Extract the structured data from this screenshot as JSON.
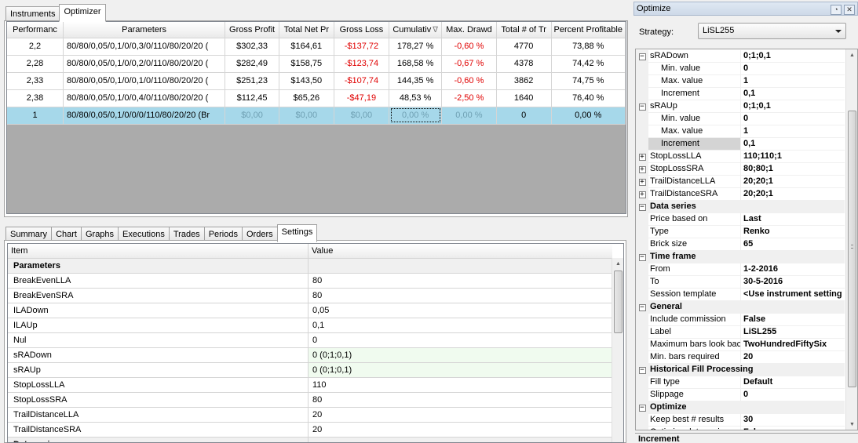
{
  "top_tabs": [
    "Instruments",
    "Optimizer"
  ],
  "results": {
    "columns": [
      "Performanc",
      "Parameters",
      "Gross Profit",
      "Total Net Pr",
      "Gross Loss",
      "Cumulativ",
      "Max. Drawd",
      "Total # of Tr",
      "Percent Profitable"
    ],
    "sort_indicator": "∇",
    "rows": [
      [
        "2,2",
        "80/80/0,05/0,1/0/0,3/0/110/80/20/20 (",
        "$302,33",
        "$164,61",
        "-$137,72",
        "178,27 %",
        "-0,60 %",
        "4770",
        "73,88 %"
      ],
      [
        "2,28",
        "80/80/0,05/0,1/0/0,2/0/110/80/20/20 (",
        "$282,49",
        "$158,75",
        "-$123,74",
        "168,58 %",
        "-0,67 %",
        "4378",
        "74,42 %"
      ],
      [
        "2,33",
        "80/80/0,05/0,1/0/0,1/0/110/80/20/20 (",
        "$251,23",
        "$143,50",
        "-$107,74",
        "144,35 %",
        "-0,60 %",
        "3862",
        "74,75 %"
      ],
      [
        "2,38",
        "80/80/0,05/0,1/0/0,4/0/110/80/20/20 (",
        "$112,45",
        "$65,26",
        "-$47,19",
        "48,53 %",
        "-2,50 %",
        "1640",
        "76,40 %"
      ],
      [
        "1",
        "80/80/0,05/0,1/0/0/0/110/80/20/20 (Br",
        "$0,00",
        "$0,00",
        "$0,00",
        "0,00 %",
        "0,00 %",
        "0",
        "0,00 %"
      ]
    ]
  },
  "bottom_tabs": [
    "Summary",
    "Chart",
    "Graphs",
    "Executions",
    "Trades",
    "Periods",
    "Orders",
    "Settings"
  ],
  "settings": {
    "headers": [
      "Item",
      "Value"
    ],
    "rows": [
      {
        "item": "Parameters",
        "value": "",
        "kind": "group"
      },
      {
        "item": "BreakEvenLLA",
        "value": "80"
      },
      {
        "item": "BreakEvenSRA",
        "value": "80"
      },
      {
        "item": "ILADown",
        "value": "0,05"
      },
      {
        "item": "ILAUp",
        "value": "0,1"
      },
      {
        "item": "Nul",
        "value": "0"
      },
      {
        "item": "sRADown",
        "value": "0 (0;1;0,1)",
        "kind": "alt"
      },
      {
        "item": "sRAUp",
        "value": "0 (0;1;0,1)",
        "kind": "alt"
      },
      {
        "item": "StopLossLLA",
        "value": "110"
      },
      {
        "item": "StopLossSRA",
        "value": "80"
      },
      {
        "item": "TrailDistanceLLA",
        "value": "20"
      },
      {
        "item": "TrailDistanceSRA",
        "value": "20"
      },
      {
        "item": "Data series",
        "value": "",
        "kind": "group"
      }
    ]
  },
  "optimize_panel": {
    "title": "Optimize",
    "strategy_label": "Strategy:",
    "strategy_value": "LiSL255",
    "properties": [
      {
        "name": "sRADown",
        "value": "0;1;0,1",
        "kind": "expander",
        "sign": "−"
      },
      {
        "name": "Min. value",
        "value": "0",
        "kind": "child"
      },
      {
        "name": "Max. value",
        "value": "1",
        "kind": "child"
      },
      {
        "name": "Increment",
        "value": "0,1",
        "kind": "child"
      },
      {
        "name": "sRAUp",
        "value": "0;1;0,1",
        "kind": "expander",
        "sign": "−"
      },
      {
        "name": "Min. value",
        "value": "0",
        "kind": "child"
      },
      {
        "name": "Max. value",
        "value": "1",
        "kind": "child"
      },
      {
        "name": "Increment",
        "value": "0,1",
        "kind": "child-selected"
      },
      {
        "name": "StopLossLLA",
        "value": "110;110;1",
        "kind": "expander",
        "sign": "+"
      },
      {
        "name": "StopLossSRA",
        "value": "80;80;1",
        "kind": "expander",
        "sign": "+"
      },
      {
        "name": "TrailDistanceLLA",
        "value": "20;20;1",
        "kind": "expander",
        "sign": "+"
      },
      {
        "name": "TrailDistanceSRA",
        "value": "20;20;1",
        "kind": "expander",
        "sign": "+"
      },
      {
        "name": "Data series",
        "value": "",
        "kind": "category"
      },
      {
        "name": "Price based on",
        "value": "Last",
        "kind": "prop"
      },
      {
        "name": "Type",
        "value": "Renko",
        "kind": "prop"
      },
      {
        "name": "Brick size",
        "value": "65",
        "kind": "prop"
      },
      {
        "name": "Time frame",
        "value": "",
        "kind": "category"
      },
      {
        "name": "From",
        "value": "1-2-2016",
        "kind": "prop"
      },
      {
        "name": "To",
        "value": "30-5-2016",
        "kind": "prop"
      },
      {
        "name": "Session template",
        "value": "<Use instrument setting",
        "kind": "prop"
      },
      {
        "name": "General",
        "value": "",
        "kind": "category"
      },
      {
        "name": "Include commission",
        "value": "False",
        "kind": "prop"
      },
      {
        "name": "Label",
        "value": "LiSL255",
        "kind": "prop"
      },
      {
        "name": "Maximum bars look bac",
        "value": "TwoHundredFiftySix",
        "kind": "prop"
      },
      {
        "name": "Min. bars required",
        "value": "20",
        "kind": "prop"
      },
      {
        "name": "Historical Fill Processing",
        "value": "",
        "kind": "category"
      },
      {
        "name": "Fill type",
        "value": "Default",
        "kind": "prop"
      },
      {
        "name": "Slippage",
        "value": "0",
        "kind": "prop"
      },
      {
        "name": "Optimize",
        "value": "",
        "kind": "category"
      },
      {
        "name": "Keep best # results",
        "value": "30",
        "kind": "prop"
      },
      {
        "name": "Optimize data series",
        "value": "False",
        "kind": "prop"
      }
    ],
    "description_title": "Increment"
  },
  "colors": {
    "negative": "#e00000",
    "selected_row": "#a6d8ea",
    "alt_value": "#f0fbef",
    "grid_background": "#ababab"
  }
}
